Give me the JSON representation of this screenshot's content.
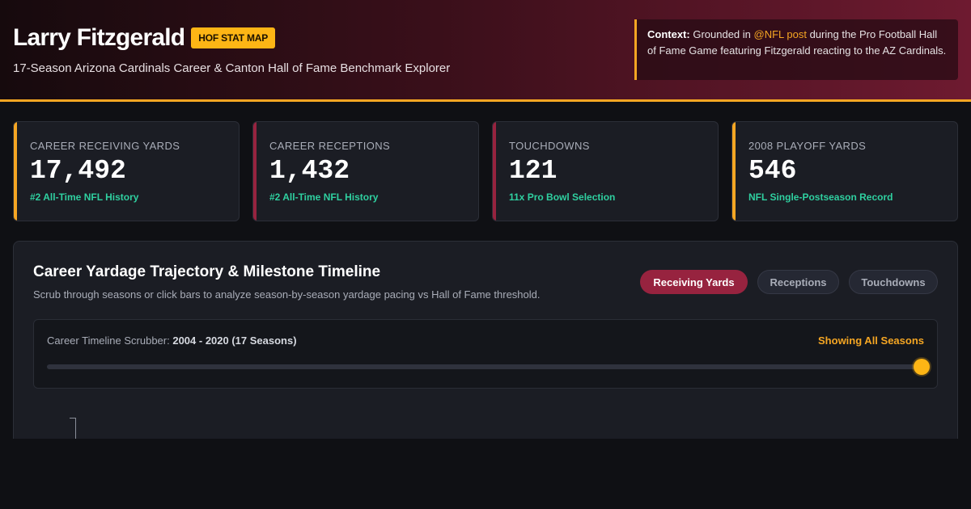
{
  "header": {
    "player_name": "Larry Fitzgerald",
    "badge": "HOF STAT MAP",
    "subtitle": "17-Season Arizona Cardinals Career & Canton Hall of Fame Benchmark Explorer",
    "context": {
      "label": "Context:",
      "text_before": " Grounded in ",
      "link": "@NFL post",
      "text_after": " during the Pro Football Hall of Fame Game featuring Fitzgerald reacting to the AZ Cardinals."
    }
  },
  "stats": [
    {
      "label": "CAREER RECEIVING YARDS",
      "value": "17,492",
      "note": "#2 All-Time NFL History",
      "accent": "#f5a623"
    },
    {
      "label": "CAREER RECEPTIONS",
      "value": "1,432",
      "note": "#2 All-Time NFL History",
      "accent": "#97233f"
    },
    {
      "label": "TOUCHDOWNS",
      "value": "121",
      "note": "11x Pro Bowl Selection",
      "accent": "#97233f"
    },
    {
      "label": "2008 PLAYOFF YARDS",
      "value": "546",
      "note": "NFL Single-Postseason Record",
      "accent": "#f5a623"
    }
  ],
  "panel": {
    "title": "Career Yardage Trajectory & Milestone Timeline",
    "description": "Scrub through seasons or click bars to analyze season-by-season yardage pacing vs Hall of Fame threshold.",
    "tabs": [
      {
        "label": "Receiving Yards",
        "active": true
      },
      {
        "label": "Receptions",
        "active": false
      },
      {
        "label": "Touchdowns",
        "active": false
      }
    ],
    "scrubber": {
      "label": "Career Timeline Scrubber: ",
      "range": "2004 - 2020 (17 Seasons)",
      "status": "Showing All Seasons",
      "position": 1.0
    }
  },
  "colors": {
    "accent_gold": "#f5a623",
    "cardinal_red": "#97233f",
    "note_green": "#2fd0a0"
  }
}
